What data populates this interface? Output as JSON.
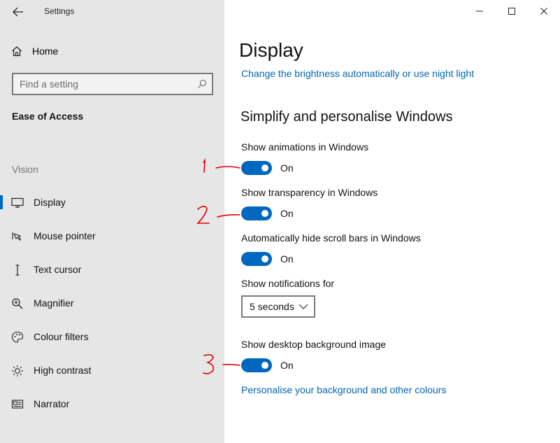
{
  "window": {
    "title": "Settings",
    "controls": [
      "minimize",
      "maximize",
      "close"
    ]
  },
  "sidebar": {
    "home_label": "Home",
    "search_placeholder": "Find a setting",
    "section_title": "Ease of Access",
    "group_label": "Vision",
    "items": [
      {
        "label": "Display",
        "icon": "monitor-icon",
        "active": true
      },
      {
        "label": "Mouse pointer",
        "icon": "mouse-pointer-icon",
        "active": false
      },
      {
        "label": "Text cursor",
        "icon": "text-cursor-icon",
        "active": false
      },
      {
        "label": "Magnifier",
        "icon": "magnifier-icon",
        "active": false
      },
      {
        "label": "Colour filters",
        "icon": "colour-filters-icon",
        "active": false
      },
      {
        "label": "High contrast",
        "icon": "high-contrast-icon",
        "active": false
      },
      {
        "label": "Narrator",
        "icon": "narrator-icon",
        "active": false
      }
    ]
  },
  "main": {
    "title": "Display",
    "brightness_link": "Change the brightness automatically or use night light",
    "section_heading": "Simplify and personalise Windows",
    "settings": [
      {
        "label": "Show animations in Windows",
        "state": "On"
      },
      {
        "label": "Show transparency in Windows",
        "state": "On"
      },
      {
        "label": "Automatically hide scroll bars in Windows",
        "state": "On"
      }
    ],
    "notifications": {
      "label": "Show notifications for",
      "value": "5 seconds"
    },
    "background": {
      "label": "Show desktop background image",
      "state": "On"
    },
    "background_link": "Personalise your background and other colours"
  },
  "annotations": {
    "color": "#e00000",
    "marks": [
      "1",
      "2",
      "3"
    ]
  },
  "colors": {
    "accent": "#0067c0",
    "link": "#0066b4",
    "sidebar_bg": "#e6e6e6"
  }
}
